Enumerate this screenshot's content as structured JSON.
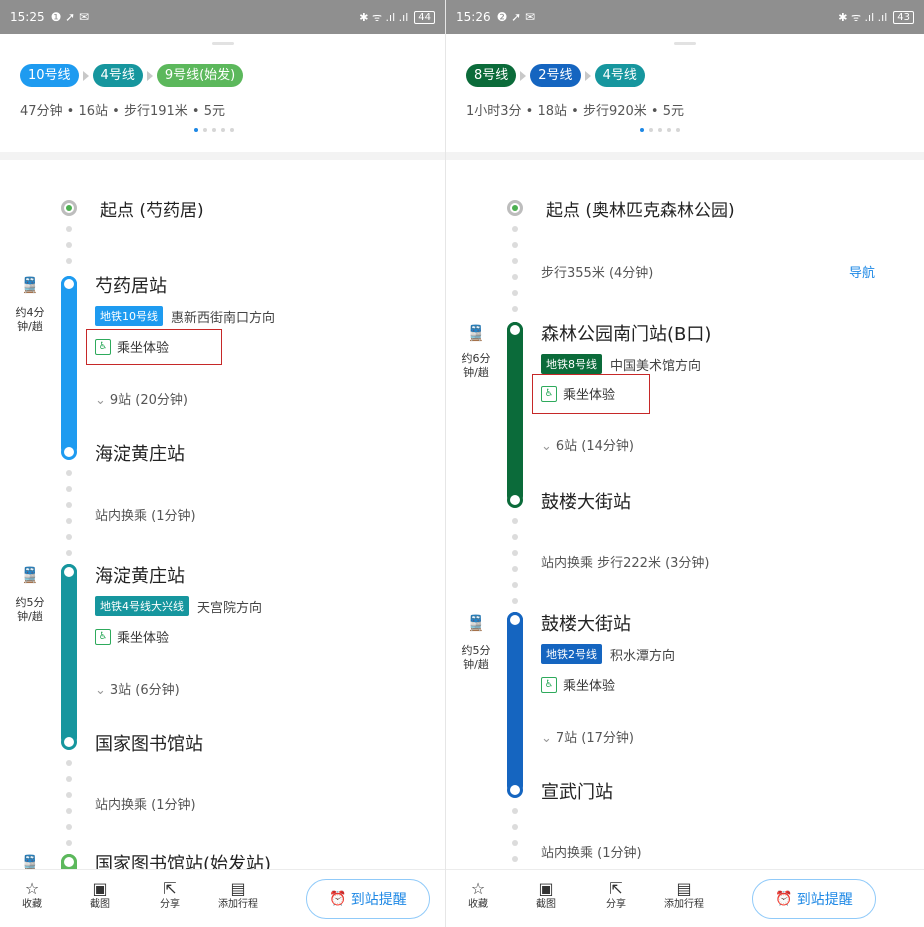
{
  "left": {
    "status": {
      "time": "15:25",
      "icons": "❶ ➚ ✉",
      "signal": "✱ ᯤ .ıl .ıl",
      "battery": "44"
    },
    "lines": [
      {
        "label": "10号线",
        "color": "#1e9bf0"
      },
      {
        "label": "4号线",
        "color": "#16969e"
      },
      {
        "label": "9号线(始发)",
        "color": "#5cb85c"
      }
    ],
    "summary": "47分钟 • 16站 • 步行191米 • 5元",
    "start": "起点 (芍药居)",
    "seg1": {
      "freq": "约4分钟/趟",
      "station": "芍药居站",
      "tag": "地铁10号线",
      "tag_color": "#1e9bf0",
      "direction": "惠新西街南口方向",
      "experience": "乘坐体验",
      "stops": "9站 (20分钟)",
      "end": "海淀黄庄站"
    },
    "transfer1": "站内换乘 (1分钟)",
    "seg2": {
      "freq": "约5分钟/趟",
      "station": "海淀黄庄站",
      "tag": "地铁4号线大兴线",
      "tag_color": "#16969e",
      "direction": "天宫院方向",
      "experience": "乘坐体验",
      "stops": "3站 (6分钟)",
      "end": "国家图书馆站"
    },
    "transfer2": "站内换乘 (1分钟)",
    "seg3_station": "国家图书馆站(始发站)"
  },
  "right": {
    "status": {
      "time": "15:26",
      "icons": "❷ ➚ ✉",
      "signal": "✱ ᯤ .ıl .ıl",
      "battery": "43"
    },
    "lines": [
      {
        "label": "8号线",
        "color": "#0b6b3a"
      },
      {
        "label": "2号线",
        "color": "#1565c0"
      },
      {
        "label": "4号线",
        "color": "#16969e"
      }
    ],
    "summary": "1小时3分 • 18站 • 步行920米 • 5元",
    "start": "起点 (奥林匹克森林公园)",
    "walk": "步行355米 (4分钟)",
    "nav": "导航",
    "seg1": {
      "freq": "约6分钟/趟",
      "station": "森林公园南门站(B口)",
      "tag": "地铁8号线",
      "tag_color": "#0b6b3a",
      "direction": "中国美术馆方向",
      "experience": "乘坐体验",
      "stops": "6站 (14分钟)",
      "end": "鼓楼大街站"
    },
    "transfer1": "站内换乘 步行222米 (3分钟)",
    "seg2": {
      "freq": "约5分钟/趟",
      "station": "鼓楼大街站",
      "tag": "地铁2号线",
      "tag_color": "#1565c0",
      "direction": "积水潭方向",
      "experience": "乘坐体验",
      "stops": "7站 (17分钟)",
      "end": "宣武门站"
    },
    "transfer2": "站内换乘 (1分钟)"
  },
  "toolbar": {
    "favorite": "收藏",
    "screenshot": "截图",
    "share": "分享",
    "add_trip": "添加行程",
    "remind": "到站提醒"
  },
  "icons": {
    "favorite": "star-outline-icon",
    "screenshot": "image-icon",
    "share": "share-icon",
    "add_trip": "calendar-icon",
    "remind": "alarm-clock-icon",
    "metro": "metro-train-icon",
    "experience": "seat-icon",
    "chevron": "chevron-down-icon"
  }
}
